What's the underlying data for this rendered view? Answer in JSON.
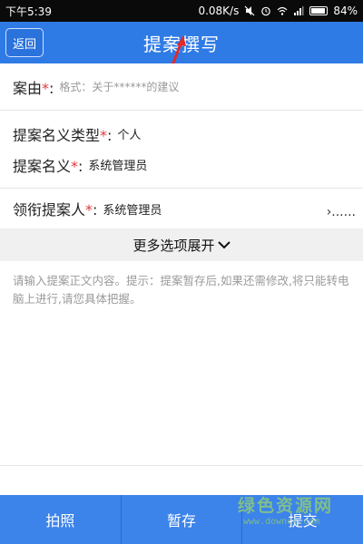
{
  "status_bar": {
    "time": "下午5:39",
    "network_speed": "0.08K/s",
    "battery": "84%"
  },
  "nav": {
    "back_label": "返回",
    "title": "提案撰写"
  },
  "form": {
    "case": {
      "label": "案由",
      "required_mark": "*",
      "colon": ":",
      "placeholder": "格式：关于******的建议"
    },
    "type": {
      "label": "提案名义类型",
      "required_mark": "*",
      "colon": ":",
      "value": "个人"
    },
    "name": {
      "label": "提案名义",
      "required_mark": "*",
      "colon": ":",
      "value": "系统管理员"
    },
    "lead": {
      "label": "领衔提案人",
      "required_mark": "*",
      "colon": ":",
      "value": "系统管理员",
      "chevron_text": "›......"
    }
  },
  "more_options": {
    "label": "更多选项展开"
  },
  "content": {
    "placeholder": "请输入提案正文内容。提示：提案暂存后,如果还需修改,将只能转电脑上进行,请您具体把握。"
  },
  "toolbar": {
    "photo_label": "拍照",
    "save_label": "暂存",
    "submit_label": "提交"
  },
  "watermark": {
    "text": "绿色资源网",
    "sub": "www.downcc.com"
  },
  "colors": {
    "nav_blue": "#2f7be6",
    "toolbar_blue": "#3c83ea",
    "required_red": "#e13a3a"
  }
}
